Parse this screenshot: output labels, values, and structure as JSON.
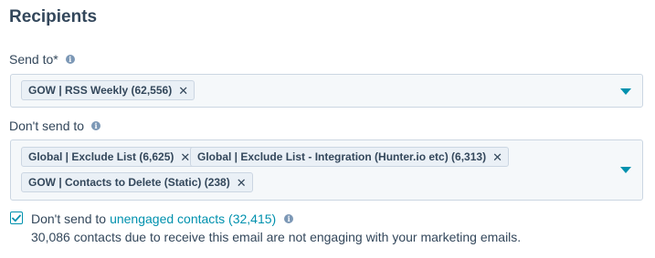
{
  "section": {
    "title": "Recipients"
  },
  "send_to": {
    "label": "Send to*",
    "tags": [
      "GOW | RSS Weekly (62,556)"
    ]
  },
  "dont_send_to": {
    "label": "Don't send to",
    "tags": [
      "Global | Exclude List (6,625)",
      "Global | Exclude List - Integration (Hunter.io etc) (6,313)",
      "GOW | Contacts to Delete (Static) (238)"
    ]
  },
  "unengaged": {
    "checked": true,
    "label_prefix": "Don't send to",
    "link_text": "unengaged contacts (32,415)",
    "helper_text": "30,086 contacts due to receive this email are not engaging with your marketing emails."
  },
  "icons": {
    "info": "info-icon",
    "remove": "x-icon",
    "dropdown": "chevron-down-icon",
    "check": "checkmark-icon"
  },
  "colors": {
    "text": "#33475b",
    "accent": "#0091ae",
    "tag_bg": "#eaf0f6",
    "field_bg": "#f5f8fa",
    "border": "#cbd6e2"
  }
}
